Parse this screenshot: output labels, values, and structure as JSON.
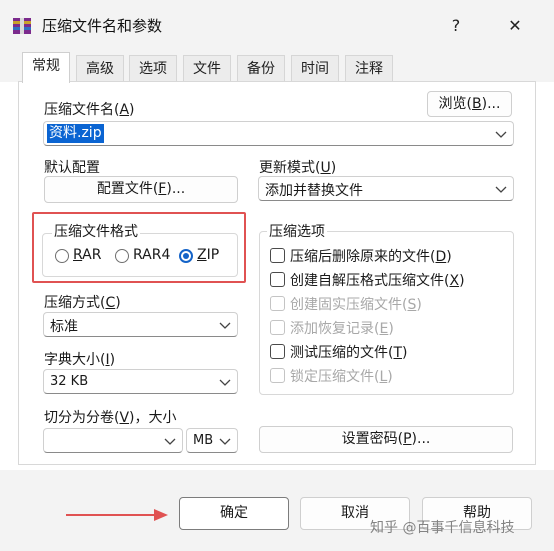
{
  "window": {
    "title": "压缩文件名和参数",
    "help_glyph": "?",
    "close_glyph": "✕"
  },
  "tabs": [
    {
      "label": "常规",
      "active": true
    },
    {
      "label": "高级"
    },
    {
      "label": "选项"
    },
    {
      "label": "文件"
    },
    {
      "label": "备份"
    },
    {
      "label": "时间"
    },
    {
      "label": "注释"
    }
  ],
  "archive_name": {
    "label_pre": "压缩文件名(",
    "label_key": "A",
    "label_post": ")",
    "value": "资料.zip",
    "browse_pre": "浏览(",
    "browse_key": "B",
    "browse_post": ")..."
  },
  "profiles": {
    "label": "默认配置",
    "button_pre": "配置文件(",
    "button_key": "F",
    "button_post": ")..."
  },
  "update_mode": {
    "label_pre": "更新模式(",
    "label_key": "U",
    "label_post": ")",
    "value": "添加并替换文件"
  },
  "archive_format": {
    "label": "压缩文件格式",
    "options": [
      {
        "key": "R",
        "rest": "AR",
        "selected": false
      },
      {
        "key": "",
        "rest": "RAR4",
        "key2": "4",
        "selected": false
      },
      {
        "key": "Z",
        "rest": "IP",
        "selected": true
      }
    ]
  },
  "archive_options": {
    "label": "压缩选项",
    "items": [
      {
        "pre": "压缩后删除原来的文件(",
        "key": "D",
        "post": ")",
        "enabled": true
      },
      {
        "pre": "创建自解压格式压缩文件(",
        "key": "X",
        "post": ")",
        "enabled": true
      },
      {
        "pre": "创建固实压缩文件(",
        "key": "S",
        "post": ")",
        "enabled": false
      },
      {
        "pre": "添加恢复记录(",
        "key": "E",
        "post": ")",
        "enabled": false
      },
      {
        "pre": "测试压缩的文件(",
        "key": "T",
        "post": ")",
        "enabled": true
      },
      {
        "pre": "锁定压缩文件(",
        "key": "L",
        "post": ")",
        "enabled": false
      }
    ]
  },
  "compression_method": {
    "label_pre": "压缩方式(",
    "label_key": "C",
    "label_post": ")",
    "value": "标准"
  },
  "dictionary_size": {
    "label_pre": "字典大小(",
    "label_key": "I",
    "label_post": ")",
    "value": "32 KB"
  },
  "split_volumes": {
    "label_pre": "切分为分卷(",
    "label_key": "V",
    "label_post": ")，大小",
    "value": "",
    "unit": "MB"
  },
  "password": {
    "pre": "设置密码(",
    "key": "P",
    "post": ")..."
  },
  "footer": {
    "ok": "确定",
    "cancel": "取消",
    "help": "帮助",
    "watermark": "知乎 @百事千信息科技"
  },
  "colors": {
    "highlight_box": "#e05252",
    "arrow": "#e05252",
    "selection": "#0a64d2",
    "radio_on": "#1463c8"
  }
}
